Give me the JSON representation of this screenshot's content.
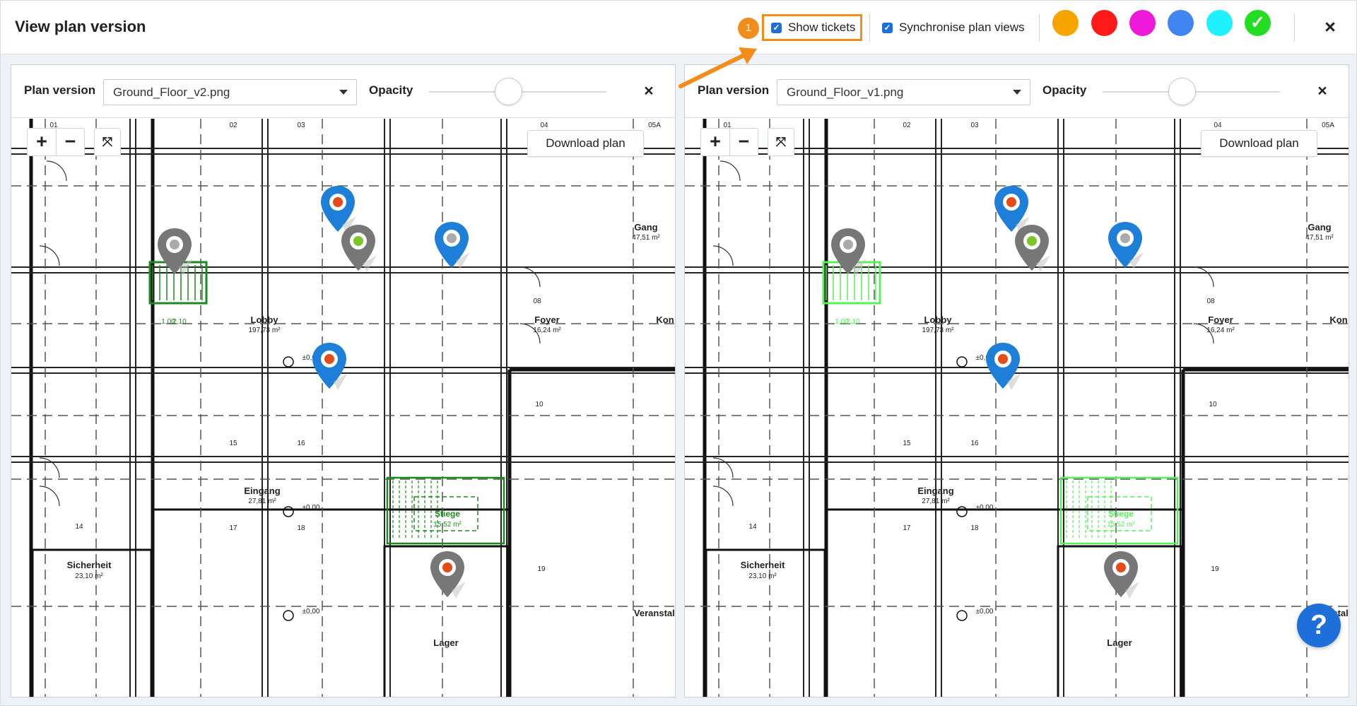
{
  "window": {
    "title": "View plan version",
    "close_label": "×"
  },
  "toolbar": {
    "step_badge": "1",
    "show_tickets_label": "Show tickets",
    "show_tickets_checked": true,
    "synchronise_label": "Synchronise plan views",
    "synchronise_checked": true,
    "colors": [
      "#f5a400",
      "#ff1a1a",
      "#ee18d8",
      "#3f86f0",
      "#1ff0ff",
      "#22dd22"
    ],
    "check_glyph": "✓"
  },
  "panels": [
    {
      "plan_version_label": "Plan version",
      "selected_plan": "Ground_Floor_v2.png",
      "opacity_label": "Opacity",
      "opacity_value": 0.45,
      "close_label": "×",
      "zoom_in": "+",
      "zoom_out": "−",
      "fit_icon": "fit-screen-icon",
      "download_label": "Download plan",
      "highlight_color": "#1d8a1d"
    },
    {
      "plan_version_label": "Plan version",
      "selected_plan": "Ground_Floor_v1.png",
      "opacity_label": "Opacity",
      "opacity_value": 0.45,
      "close_label": "×",
      "zoom_in": "+",
      "zoom_out": "−",
      "fit_icon": "fit-screen-icon",
      "download_label": "Download plan",
      "highlight_color": "#56f057"
    }
  ],
  "plan_labels": {
    "rooms": [
      "Lobby",
      "Foyer",
      "Gang",
      "Eingang",
      "Stiege",
      "Sicherheit",
      "Kon",
      "Veranstalt",
      "Lager"
    ],
    "areas": [
      "197,73 m²",
      "16,24 m²",
      "47,51 m²",
      "27,81 m²",
      "15,52 m²",
      "23,10 m²"
    ],
    "numbers": [
      "01",
      "02",
      "03",
      "04",
      "05A",
      "08",
      "10",
      "14",
      "15",
      "16",
      "17",
      "18",
      "19"
    ],
    "dims": [
      "1,00",
      "2,10",
      "±0,00"
    ]
  },
  "help": {
    "label": "?"
  }
}
